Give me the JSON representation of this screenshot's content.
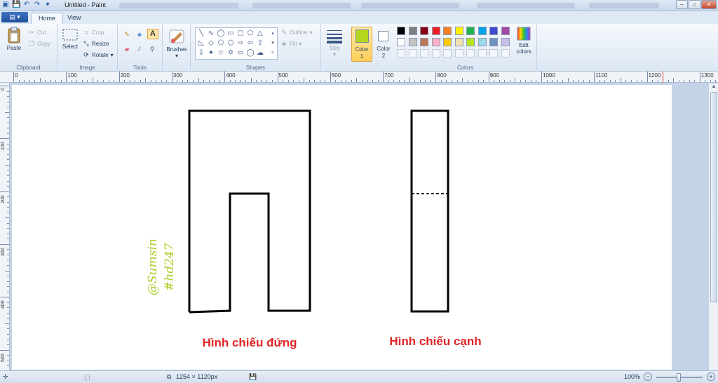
{
  "window": {
    "title": "Untitled - Paint"
  },
  "tabs": {
    "app_menu": "▤ ▾",
    "home": "Home",
    "view": "View"
  },
  "ribbon": {
    "clipboard": {
      "label": "Clipboard",
      "paste": "Paste",
      "cut": "Cut",
      "copy": "Copy"
    },
    "image": {
      "label": "Image",
      "select": "Select",
      "crop": "Crop",
      "resize": "Resize",
      "rotate": "Rotate"
    },
    "tools": {
      "label": "Tools"
    },
    "brushes": {
      "label": "Brushes"
    },
    "shapes": {
      "label": "Shapes",
      "outline": "Outline",
      "fill": "Fill"
    },
    "size": {
      "label": "Size"
    },
    "color1": {
      "label_top": "Color",
      "label_bottom": "1",
      "value": "#b5d61e"
    },
    "color2": {
      "label_top": "Color",
      "label_bottom": "2",
      "value": "#ffffff"
    },
    "colors": {
      "label": "Colors",
      "edit": "Edit colors"
    },
    "palette": [
      "#000000",
      "#7f7f7f",
      "#880015",
      "#ed1c24",
      "#ff7f27",
      "#fff200",
      "#22b14c",
      "#00a2e8",
      "#3f48cc",
      "#a349a4",
      "#ffffff",
      "#c3c3c3",
      "#b97a57",
      "#ffaec9",
      "#ffc90e",
      "#efe4b0",
      "#b5e61d",
      "#99d9ea",
      "#7092be",
      "#c8bfe7"
    ]
  },
  "ruler": {
    "top_labels": [
      "0",
      "100",
      "200",
      "300",
      "400",
      "500",
      "600",
      "700",
      "800",
      "900",
      "1000",
      "1100",
      "1200",
      "1300"
    ],
    "left_labels": [
      "0",
      "100",
      "200",
      "300",
      "400",
      "500"
    ]
  },
  "canvas": {
    "watermark_line1": "@Sumsin",
    "watermark_line2": "#hd247",
    "watermark_color": "#a9cf2a",
    "caption_front": "Hình chiếu đứng",
    "caption_side": "Hình chiếu cạnh",
    "caption_color": "#e02424"
  },
  "status": {
    "dimensions": "1254 × 1120px",
    "zoom": "100%"
  }
}
